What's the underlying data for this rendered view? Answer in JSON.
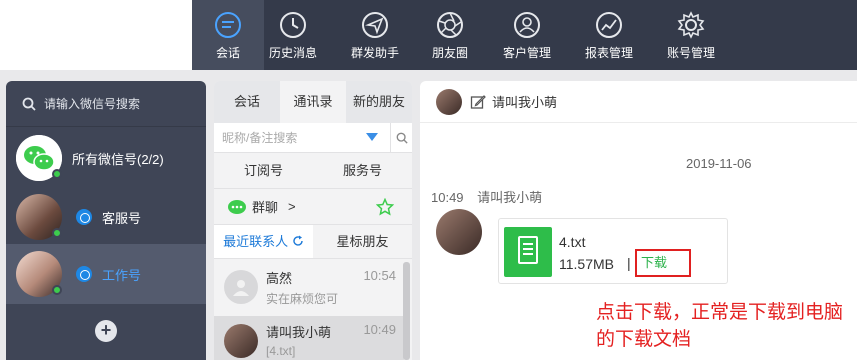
{
  "nav": {
    "items": [
      {
        "label": "会话",
        "icon": "chat-icon"
      },
      {
        "label": "历史消息",
        "icon": "clock-icon"
      },
      {
        "label": "群发助手",
        "icon": "send-icon"
      },
      {
        "label": "朋友圈",
        "icon": "aperture-icon"
      },
      {
        "label": "客户管理",
        "icon": "user-icon"
      },
      {
        "label": "报表管理",
        "icon": "report-icon"
      },
      {
        "label": "账号管理",
        "icon": "gear-icon"
      }
    ],
    "active_index": 0
  },
  "accounts": {
    "search_placeholder": "请输入微信号搜索",
    "all_label": "所有微信号(2/2)",
    "items": [
      {
        "label": "客服号"
      },
      {
        "label": "工作号"
      }
    ]
  },
  "contacts": {
    "tabs": [
      "会话",
      "通讯录",
      "新的朋友"
    ],
    "search_placeholder": "昵称/备注搜索",
    "subscription": "订阅号",
    "service": "服务号",
    "group_chat": "群聊",
    "group_arrow": ">",
    "recent": "最近联系人",
    "starred": "星标朋友",
    "conversations": [
      {
        "name": "高然",
        "message": "实在麻烦您可",
        "time": "10:54"
      },
      {
        "name": "请叫我小萌",
        "message": "[4.txt]",
        "time": "10:49"
      }
    ]
  },
  "chat": {
    "title": "请叫我小萌",
    "date": "2019-11-06",
    "message_time": "10:49",
    "sender": "请叫我小萌",
    "file": {
      "name": "4.txt",
      "size": "11.57MB",
      "separator": "|",
      "download_label": "下载"
    },
    "annotation": "点击下载，正常是下载到电脑的下载文档"
  },
  "colors": {
    "topbar": "#343a4a",
    "accent_blue": "#1d7ad8",
    "file_green": "#2ebd4a",
    "annotation_red": "#e42121"
  }
}
